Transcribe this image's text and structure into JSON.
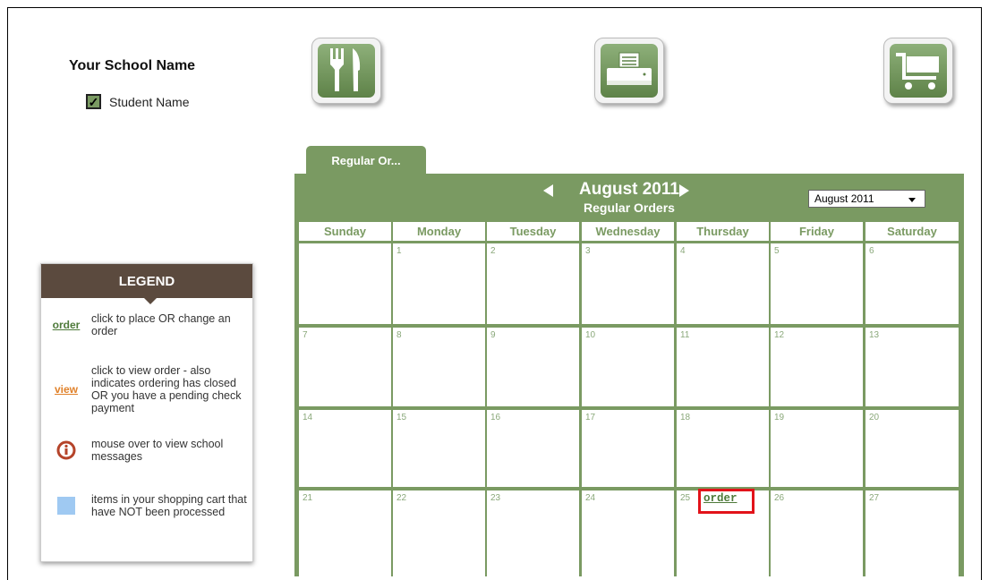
{
  "header": {
    "school_name": "Your School Name",
    "student_name": "Student Name",
    "student_checked": true
  },
  "top_icons": [
    {
      "name": "menu",
      "icon": "fork-knife-icon"
    },
    {
      "name": "print",
      "icon": "printer-icon"
    },
    {
      "name": "cart",
      "icon": "shopping-cart-icon"
    }
  ],
  "legend": {
    "title": "LEGEND",
    "items": [
      {
        "icon_text": "order",
        "text": "click to place OR change an order"
      },
      {
        "icon_text": "view",
        "text": "click to view order - also indicates ordering has closed OR you have a pending check payment"
      },
      {
        "icon": "info-icon",
        "text": "mouse over to view school messages"
      },
      {
        "icon": "blue-square-icon",
        "text": "items in your shopping cart that have NOT been processed"
      }
    ]
  },
  "tab": {
    "label": "Regular Or..."
  },
  "calendar": {
    "month_label": "August 2011",
    "subtitle": "Regular Orders",
    "select_value": "August 2011",
    "days": [
      "Sunday",
      "Monday",
      "Tuesday",
      "Wednesday",
      "Thursday",
      "Friday",
      "Saturday"
    ],
    "weeks": [
      [
        "",
        "1",
        "2",
        "3",
        "4",
        "5",
        "6"
      ],
      [
        "7",
        "8",
        "9",
        "10",
        "11",
        "12",
        "13"
      ],
      [
        "14",
        "15",
        "16",
        "17",
        "18",
        "19",
        "20"
      ],
      [
        "21",
        "22",
        "23",
        "24",
        "25",
        "26",
        "27"
      ]
    ],
    "order_link": {
      "week": 3,
      "day": 4,
      "label": "order"
    }
  },
  "colors": {
    "accent": "#7a9a62",
    "legend_header": "#5b4a3e",
    "highlight": "#e2131a",
    "view": "#e0812a",
    "cart_pending": "#9fc9f2"
  }
}
